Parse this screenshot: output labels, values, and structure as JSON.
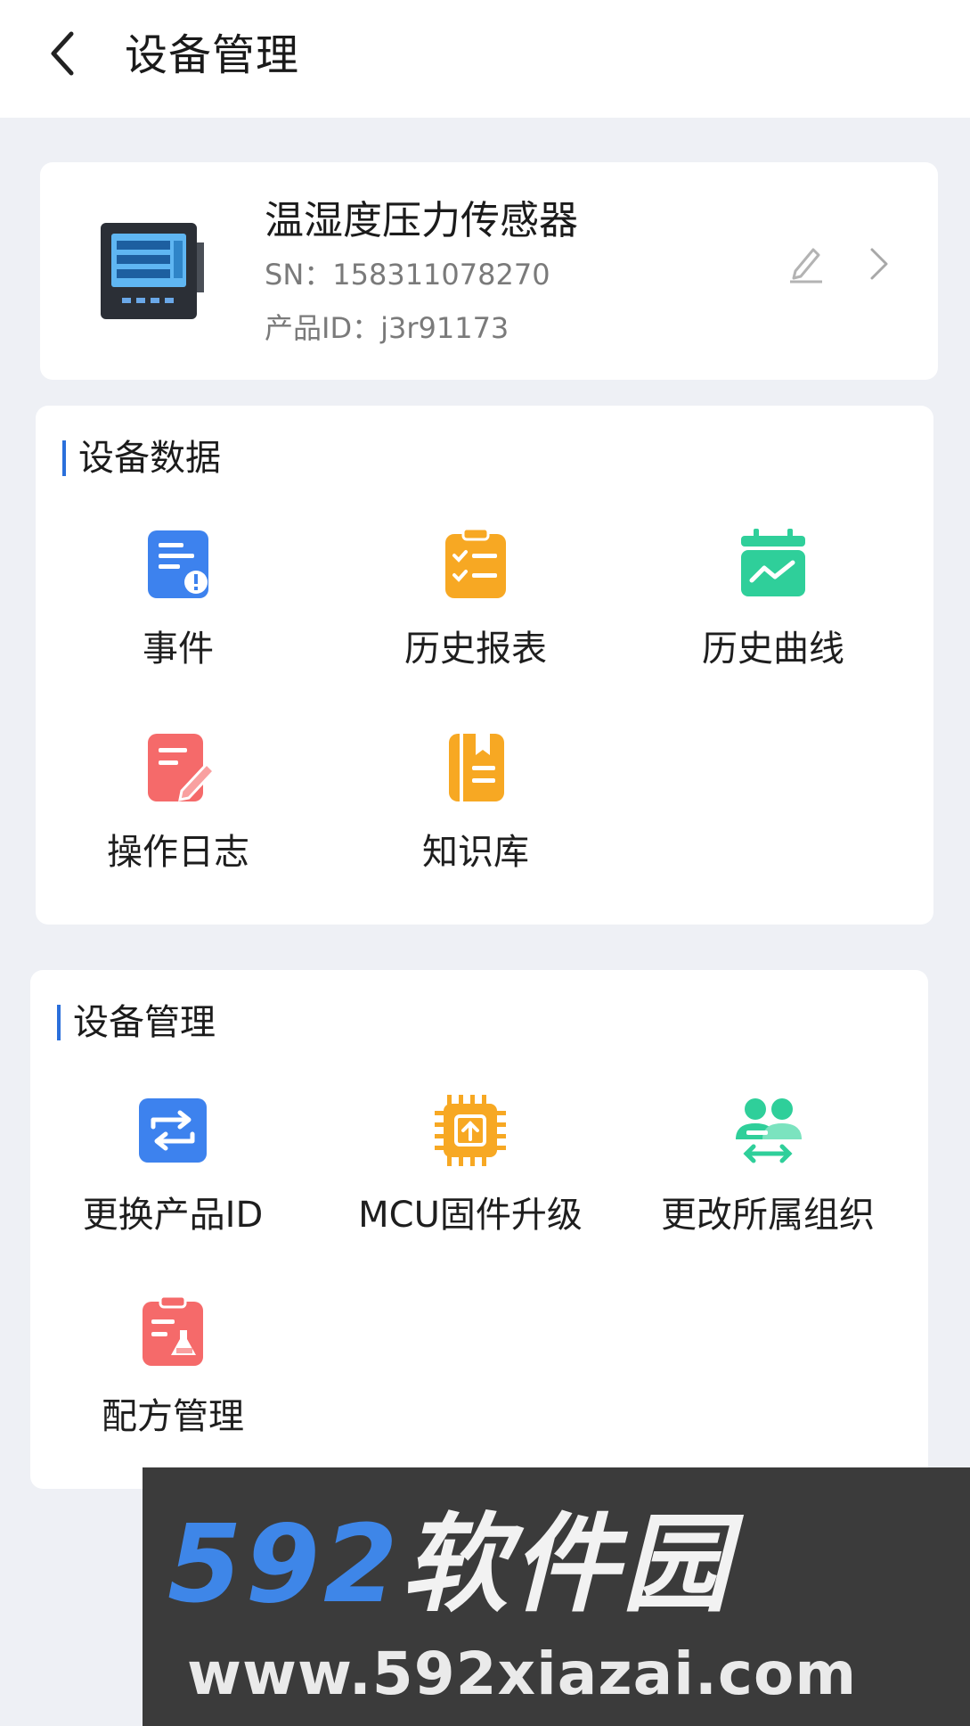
{
  "header": {
    "title": "设备管理"
  },
  "device": {
    "name": "温湿度压力传感器",
    "sn": "SN：158311078270",
    "product_id": "产品ID：j3r91173"
  },
  "sections": [
    {
      "title": "设备数据",
      "items": [
        {
          "label": "事件",
          "icon": "event-alert-icon",
          "color": "#3d82ee"
        },
        {
          "label": "历史报表",
          "icon": "report-clipboard-icon",
          "color": "#f7a823"
        },
        {
          "label": "历史曲线",
          "icon": "curve-calendar-icon",
          "color": "#2fcf9a"
        },
        {
          "label": "操作日志",
          "icon": "log-edit-icon",
          "color": "#f56a6a"
        },
        {
          "label": "知识库",
          "icon": "knowledge-book-icon",
          "color": "#f7a823"
        }
      ]
    },
    {
      "title": "设备管理",
      "items": [
        {
          "label": "更换产品ID",
          "icon": "swap-icon",
          "color": "#3d82ee"
        },
        {
          "label": "MCU固件升级",
          "icon": "chip-upgrade-icon",
          "color": "#f7a823"
        },
        {
          "label": "更改所属组织",
          "icon": "group-transfer-icon",
          "color": "#2fcf9a"
        },
        {
          "label": "配方管理",
          "icon": "recipe-flask-icon",
          "color": "#f56a6a"
        }
      ]
    }
  ],
  "watermark": {
    "logo_num": "592",
    "logo_cn": "软件园",
    "url": "www.592xiazai.com"
  }
}
